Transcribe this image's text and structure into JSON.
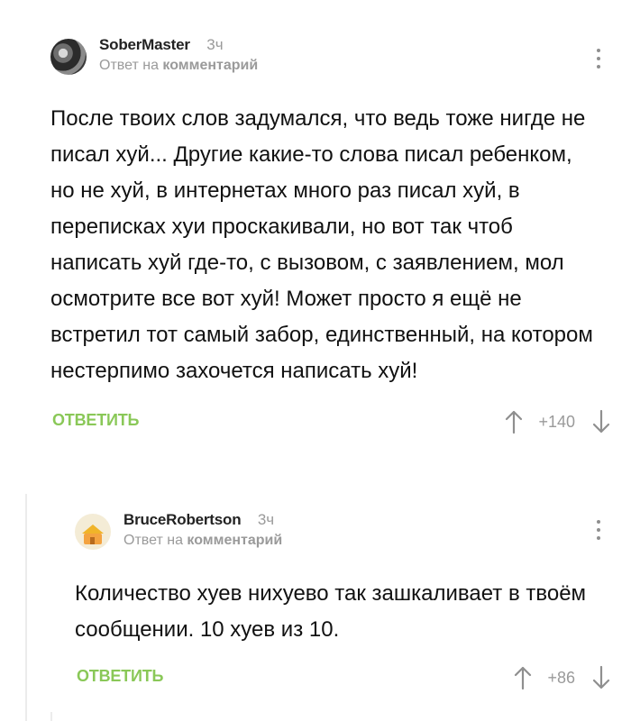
{
  "comments": [
    {
      "author": "SoberMaster",
      "time": "3ч",
      "reply_prefix": "Ответ на",
      "reply_target": "комментарий",
      "text": "После твоих слов задумался, что ведь тоже нигде не писал хуй... Другие какие-то слова писал ребенком, но не хуй, в интернетах много раз писал хуй, в переписках хуи проскакивали, но вот так чтоб написать хуй где-то, с вызовом, с заявлением, мол осмотрите все вот хуй! Может просто я ещё не встретил тот самый забор, единственный, на котором нестерпимо захочется написать хуй!",
      "reply_label": "ОТВЕТИТЬ",
      "rating": "+140"
    },
    {
      "author": "BruceRobertson",
      "time": "3ч",
      "reply_prefix": "Ответ на",
      "reply_target": "комментарий",
      "text": "Количество хуев нихуево так зашкаливает в твоём сообщении. 10 хуев из 10.",
      "reply_label": "ОТВЕТИТЬ",
      "rating": "+86"
    }
  ],
  "icons": {
    "more": "more-vertical-icon",
    "upvote": "arrow-up-icon",
    "downvote": "arrow-down-icon"
  },
  "colors": {
    "accent": "#8ac858",
    "muted": "#9a9a9a",
    "thread_line": "#ececec"
  }
}
